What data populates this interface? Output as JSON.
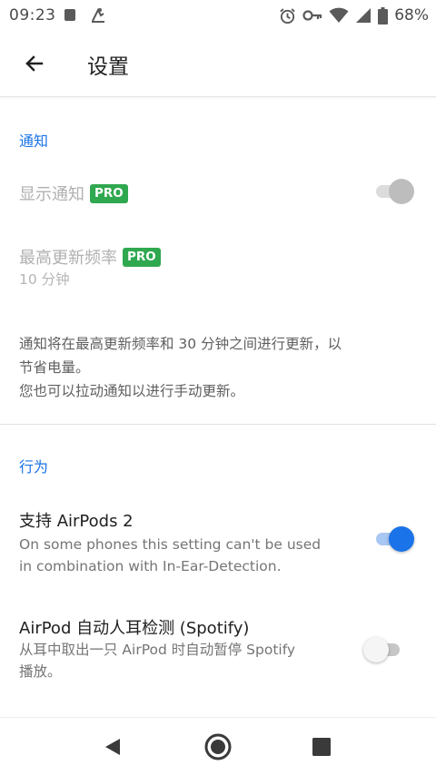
{
  "status_bar": {
    "time": "09:23",
    "battery_pct": "68%",
    "icons": [
      "square-notification-icon",
      "notification-icon",
      "alarm-icon",
      "key-icon",
      "wifi-icon",
      "signal-icon",
      "battery-icon"
    ]
  },
  "app_bar": {
    "title": "设置",
    "back_icon": "arrow-back-icon"
  },
  "sections": {
    "notifications": {
      "header": "通知",
      "show_notification": {
        "title": "显示通知",
        "badge": "PRO",
        "enabled": false,
        "checked": false
      },
      "max_update_freq": {
        "title": "最高更新频率",
        "badge": "PRO",
        "value": "10 分钟",
        "enabled": false
      },
      "note_line1": "通知将在最高更新频率和 30 分钟之间进行更新，以",
      "note_line2": "节省电量。",
      "note_line3": "您也可以拉动通知以进行手动更新。"
    },
    "behavior": {
      "header": "行为",
      "airpods2": {
        "title": "支持 AirPods 2",
        "summary_line1": "On some phones this setting can't be used",
        "summary_line2": "in combination with In-Ear-Detection.",
        "checked": true
      },
      "ear_detection": {
        "title": "AirPod 自动人耳检测 (Spotify)",
        "summary_line1": "从耳中取出一只 AirPod 时自动暂停 Spotify",
        "summary_line2": "播放。",
        "checked": false
      }
    }
  },
  "colors": {
    "accent": "#1a73e8",
    "pro_badge": "#2fa84f"
  },
  "nav_bar": {
    "icons": [
      "nav-back-icon",
      "nav-home-icon",
      "nav-recents-icon"
    ]
  }
}
